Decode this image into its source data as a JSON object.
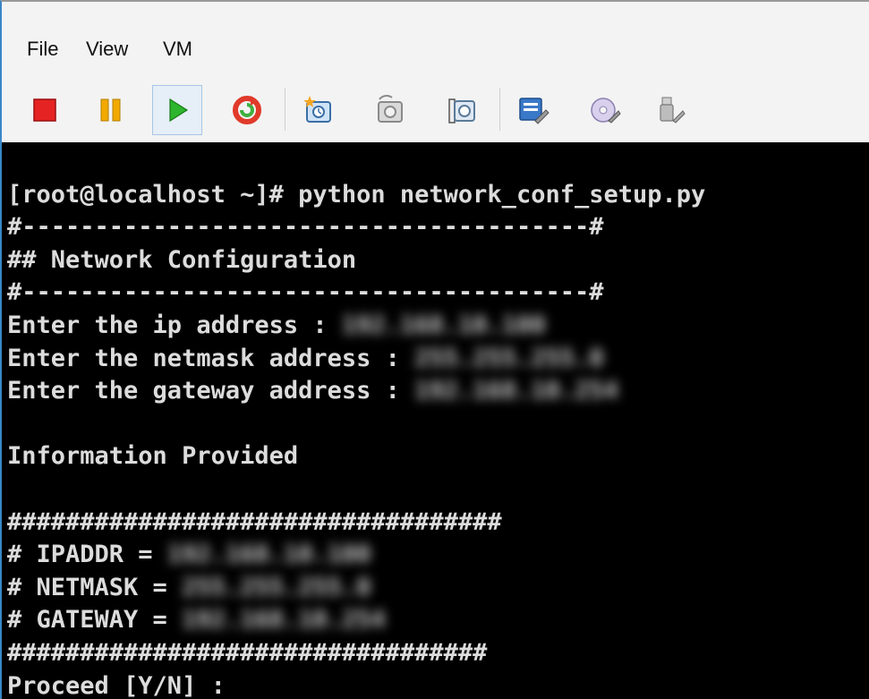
{
  "menu": {
    "file": "File",
    "view": "View",
    "vm": "VM"
  },
  "toolbar": {
    "buttons": [
      {
        "name": "stop-icon"
      },
      {
        "name": "pause-icon"
      },
      {
        "name": "play-icon"
      },
      {
        "name": "reset-icon"
      },
      {
        "name": "snapshot-take-icon"
      },
      {
        "name": "snapshot-revert-icon"
      },
      {
        "name": "snapshot-manager-icon"
      },
      {
        "name": "settings-icon"
      },
      {
        "name": "cd-dvd-icon"
      },
      {
        "name": "usb-device-icon"
      }
    ],
    "colors": {
      "stop": "#e52323",
      "pause": "#f2a900",
      "play": "#2db52d",
      "reset": "#e03a2a",
      "accent": "#3a86c8"
    }
  },
  "terminal": {
    "command_line": "[root@localhost ~]# python network_conf_setup.py",
    "separator_top": "#---------------------------------------#",
    "header": "## Network Configuration",
    "separator_bottom": "#---------------------------------------#",
    "ip_prompt": "Enter the ip address : ",
    "ip_value": "192.168.10.100",
    "netmask_prompt": "Enter the netmask address : ",
    "netmask_value": "255.255.255.0",
    "gateway_prompt": "Enter the gateway address : ",
    "gateway_value": "192.168.10.254",
    "info_heading": "Information Provided",
    "hash_line_top": "##################################",
    "ipaddr_label": "# IPADDR = ",
    "ipaddr_value": "192.168.10.100",
    "netmask_label": "# NETMASK = ",
    "netmask_summary_value": "255.255.255.0",
    "gateway_label": "# GATEWAY = ",
    "gateway_summary_value": "192.168.10.254",
    "hash_line_bottom": "#################################",
    "proceed_prompt": "Proceed [Y/N] : "
  }
}
